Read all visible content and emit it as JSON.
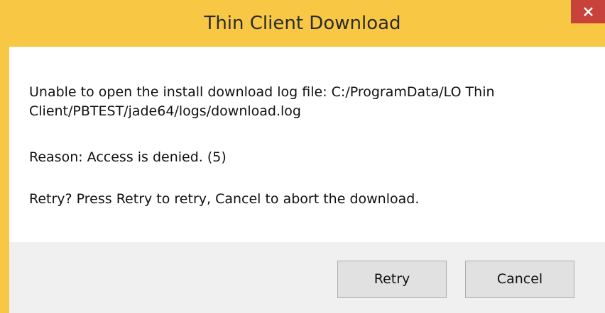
{
  "window": {
    "title": "Thin Client Download",
    "close_glyph": "×"
  },
  "message": {
    "line_error": "Unable to open the install download log file: C:/ProgramData/LO Thin Client/PBTEST/jade64/logs/download.log",
    "line_reason": "Reason: Access is denied. (5)",
    "line_prompt": "Retry? Press Retry to retry, Cancel to abort the download."
  },
  "buttons": {
    "retry_label": "Retry",
    "cancel_label": "Cancel"
  },
  "colors": {
    "titlebar": "#f8c845",
    "close_button": "#c7423b",
    "client_bg": "#ffffff",
    "footer_bg": "#f0f0f0",
    "button_bg": "#e1e1e1"
  },
  "icons": {
    "close": "close-icon"
  }
}
